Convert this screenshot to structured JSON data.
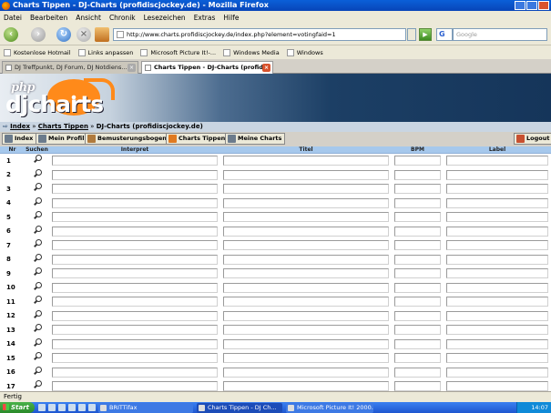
{
  "window": {
    "title": "Charts Tippen - DJ-Charts (profidiscjockey.de) - Mozilla Firefox"
  },
  "menu": [
    "Datei",
    "Bearbeiten",
    "Ansicht",
    "Chronik",
    "Lesezeichen",
    "Extras",
    "Hilfe"
  ],
  "nav": {
    "url": "http://www.charts.profidiscjockey.de/index.php?element=votingfaid=1",
    "search_placeholder": "Google",
    "search_engine": "G"
  },
  "bookmarks": [
    "Kostenlose Hotmail",
    "Links anpassen",
    "Microsoft Picture It!-...",
    "Windows Media",
    "Windows"
  ],
  "tabs": [
    {
      "label": "DJ Treffpunkt, DJ Forum, DJ Notdiens...",
      "active": false
    },
    {
      "label": "Charts Tippen - DJ-Charts (profid...",
      "active": true
    }
  ],
  "logo": {
    "small": "php",
    "main": "djcharts"
  },
  "breadcrumb": {
    "link1": "Index",
    "sep": "»",
    "link2": "Charts Tippen",
    "current": "DJ-Charts (profidiscjockey.de)"
  },
  "actions": [
    {
      "label": "Index",
      "color": "#6b7b8c"
    },
    {
      "label": "Mein Profil",
      "color": "#6b7b8c"
    },
    {
      "label": "Bemusterungsbogen",
      "color": "#b07a3c"
    },
    {
      "label": "Charts Tippen",
      "color": "#e07a20"
    },
    {
      "label": "Meine Charts",
      "color": "#6b7b8c"
    }
  ],
  "logout": {
    "label": "Logout",
    "color": "#c85030"
  },
  "table": {
    "headers": {
      "nr": "Nr",
      "suchen": "Suchen",
      "interpret": "Interpret",
      "titel": "Titel",
      "bpm": "BPM",
      "label": "Label"
    },
    "rows": [
      "1",
      "2",
      "3",
      "4",
      "5",
      "6",
      "7",
      "8",
      "9",
      "10",
      "11",
      "12",
      "13",
      "14",
      "15",
      "16",
      "17"
    ]
  },
  "status": {
    "text": "Fertig"
  },
  "taskbar": {
    "start": "Start",
    "items": [
      "BRITTifax",
      "Charts Tippen - DJ Ch...",
      "Microsoft Picture It! 2000..."
    ],
    "clock": "14:07"
  }
}
